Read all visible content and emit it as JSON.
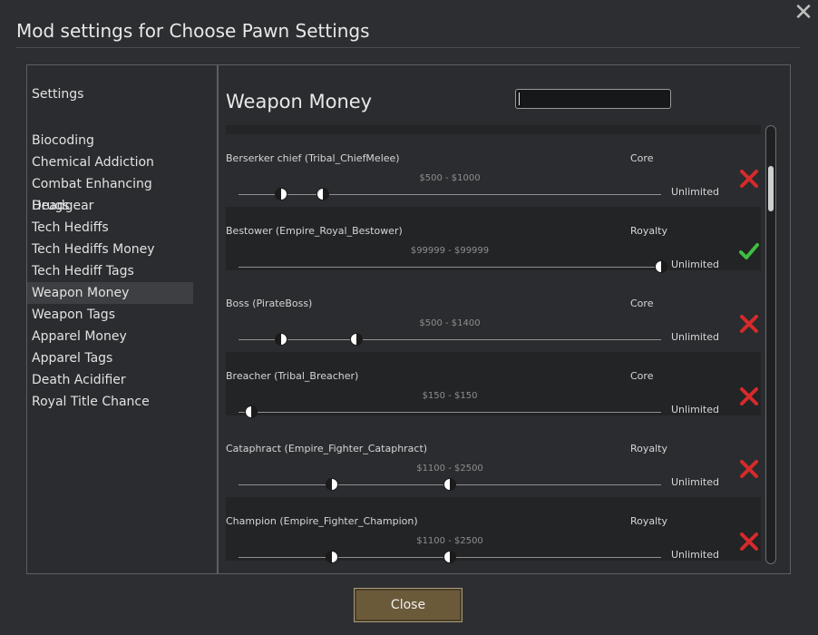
{
  "window": {
    "title": "Mod settings for Choose Pawn Settings"
  },
  "sidebar": {
    "heading": "Settings",
    "items": [
      {
        "label": "Biocoding",
        "selected": false
      },
      {
        "label": "Chemical Addiction",
        "selected": false
      },
      {
        "label": "Combat Enhancing Drugs",
        "selected": false
      },
      {
        "label": "Headgear",
        "selected": false
      },
      {
        "label": "Tech Hediffs",
        "selected": false
      },
      {
        "label": "Tech Hediffs Money",
        "selected": false
      },
      {
        "label": "Tech Hediff Tags",
        "selected": false
      },
      {
        "label": "Weapon Money",
        "selected": true
      },
      {
        "label": "Weapon Tags",
        "selected": false
      },
      {
        "label": "Apparel Money",
        "selected": false
      },
      {
        "label": "Apparel Tags",
        "selected": false
      },
      {
        "label": "Death Acidifier",
        "selected": false
      },
      {
        "label": "Royal Title Chance",
        "selected": false
      }
    ]
  },
  "content": {
    "heading": "Weapon Money",
    "search": {
      "value": "",
      "placeholder": ""
    },
    "rows": [
      {
        "name": "Berserker chief (Tribal_ChiefMelee)",
        "source": "Core",
        "range": "$500 - $1000",
        "limit": "Unlimited",
        "status": "disabled",
        "min": 500,
        "max": 1000
      },
      {
        "name": "Bestower (Empire_Royal_Bestower)",
        "source": "Royalty",
        "range": "$99999 - $99999",
        "limit": "Unlimited",
        "status": "enabled",
        "min": 99999,
        "max": 99999
      },
      {
        "name": "Boss (PirateBoss)",
        "source": "Core",
        "range": "$500 - $1400",
        "limit": "Unlimited",
        "status": "disabled",
        "min": 500,
        "max": 1400
      },
      {
        "name": "Breacher (Tribal_Breacher)",
        "source": "Core",
        "range": "$150 - $150",
        "limit": "Unlimited",
        "status": "disabled",
        "min": 150,
        "max": 150
      },
      {
        "name": "Cataphract (Empire_Fighter_Cataphract)",
        "source": "Royalty",
        "range": "$1100 - $2500",
        "limit": "Unlimited",
        "status": "disabled",
        "min": 1100,
        "max": 2500
      },
      {
        "name": "Champion (Empire_Fighter_Champion)",
        "source": "Royalty",
        "range": "$1100 - $2500",
        "limit": "Unlimited",
        "status": "disabled",
        "min": 1100,
        "max": 2500
      }
    ]
  },
  "buttons": {
    "close": "Close"
  },
  "colors": {
    "enabled": "#3fbf3f",
    "disabled": "#d62a2a",
    "button": "#6b5a3a"
  },
  "icons": {
    "close": "close-icon",
    "enabled": "checkmark-icon",
    "disabled": "cross-icon"
  }
}
